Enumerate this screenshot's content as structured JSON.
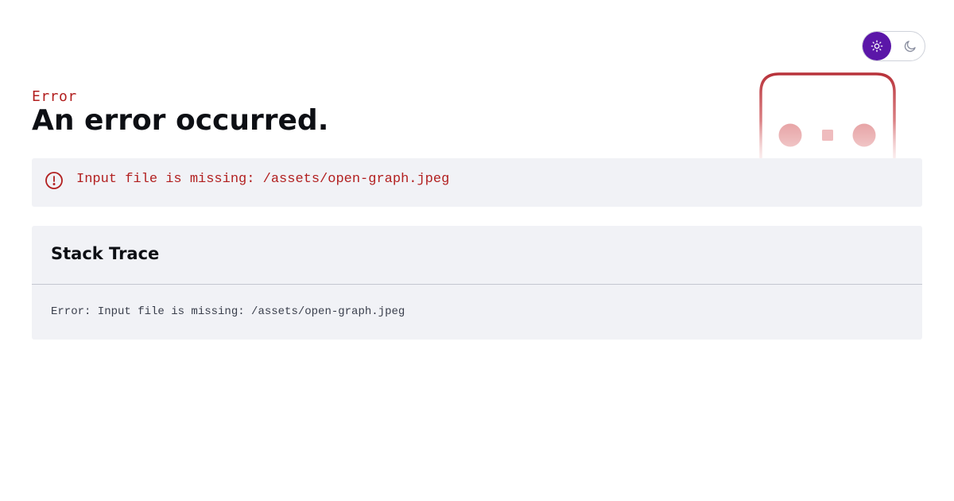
{
  "theme_toggle": {
    "active": "light",
    "options": [
      {
        "name": "light",
        "icon": "sun-icon"
      },
      {
        "name": "dark",
        "icon": "moon-icon"
      }
    ]
  },
  "error": {
    "eyebrow": "Error",
    "title": "An error occurred.",
    "message": "Input file is missing: /assets/open-graph.jpeg",
    "message_icon": "alert-circle-icon"
  },
  "stack": {
    "title": "Stack Trace",
    "body": "Error: Input file is missing: /assets/open-graph.jpeg"
  },
  "mascot": {
    "icon": "robot-face-icon"
  },
  "colors": {
    "accent": "#5b16a8",
    "error_red": "#b21f1f",
    "panel_bg": "#f1f2f6",
    "title_text": "#0d0f14"
  }
}
